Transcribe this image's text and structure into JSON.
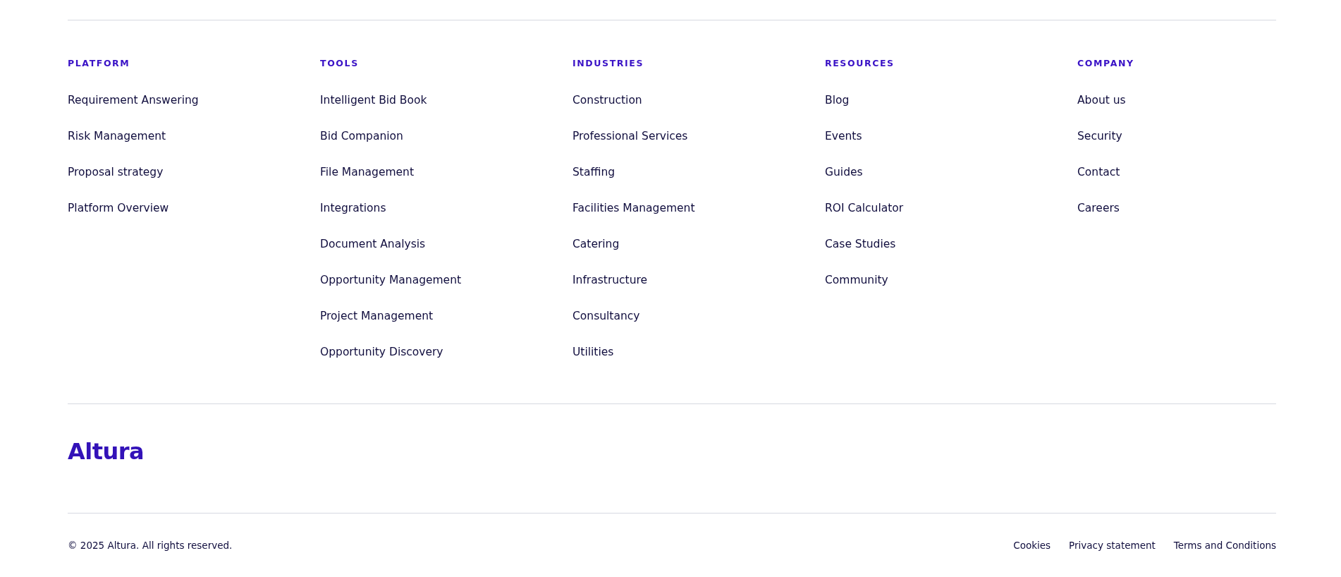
{
  "footer": {
    "columns": [
      {
        "heading": "PLATFORM",
        "links": [
          "Requirement Answering",
          "Risk Management",
          "Proposal strategy",
          "Platform Overview"
        ]
      },
      {
        "heading": "TOOLS",
        "links": [
          "Intelligent Bid Book",
          "Bid Companion",
          "File Management",
          "Integrations",
          "Document Analysis",
          "Opportunity Management",
          "Project Management",
          "Opportunity Discovery"
        ]
      },
      {
        "heading": "INDUSTRIES",
        "links": [
          "Construction",
          "Professional Services",
          "Staffing",
          "Facilities Management",
          "Catering",
          "Infrastructure",
          "Consultancy",
          "Utilities"
        ]
      },
      {
        "heading": "RESOURCES",
        "links": [
          "Blog",
          "Events",
          "Guides",
          "ROI Calculator",
          "Case Studies",
          "Community"
        ]
      },
      {
        "heading": "COMPANY",
        "links": [
          "About us",
          "Security",
          "Contact",
          "Careers"
        ]
      }
    ],
    "logo": "Altura",
    "copyright": "© 2025 Altura. All rights reserved.",
    "legal_links": [
      "Cookies",
      "Privacy statement",
      "Terms and Conditions"
    ]
  }
}
